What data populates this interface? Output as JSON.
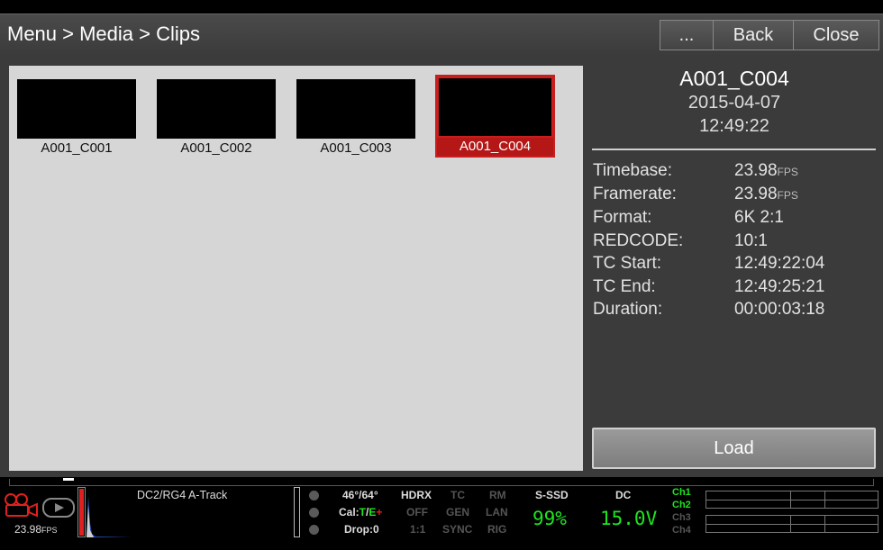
{
  "header": {
    "breadcrumb": "Menu > Media > Clips",
    "more_label": "...",
    "back_label": "Back",
    "close_label": "Close"
  },
  "clips": [
    {
      "name": "A001_C001",
      "selected": false
    },
    {
      "name": "A001_C002",
      "selected": false
    },
    {
      "name": "A001_C003",
      "selected": false
    },
    {
      "name": "A001_C004",
      "selected": true
    }
  ],
  "info": {
    "clip_name": "A001_C004",
    "date": "2015-04-07",
    "time": "12:49:22",
    "fields": [
      {
        "label": "Timebase:",
        "value": "23.98",
        "unit": "FPS"
      },
      {
        "label": "Framerate:",
        "value": "23.98",
        "unit": "FPS"
      },
      {
        "label": "Format:",
        "value": "6K 2:1",
        "unit": ""
      },
      {
        "label": "REDCODE:",
        "value": "10:1",
        "unit": ""
      },
      {
        "label": "TC Start:",
        "value": "12:49:22:04",
        "unit": ""
      },
      {
        "label": "TC End:",
        "value": "12:49:25:21",
        "unit": ""
      },
      {
        "label": "Duration:",
        "value": "00:00:03:18",
        "unit": ""
      }
    ],
    "load_label": "Load"
  },
  "status": {
    "fps": "23.98",
    "fps_unit": "FPS",
    "color_info": "DC2/RG4  A-Track",
    "shutter": "46°/64°",
    "cal_prefix": "Cal:",
    "cal_t": "T",
    "cal_sep": "/",
    "cal_e": "E",
    "cal_plus": "+",
    "drop": "Drop:0",
    "col1": [
      "HDRX",
      "OFF",
      "1:1"
    ],
    "col2": [
      "TC",
      "GEN",
      "SYNC"
    ],
    "col3": [
      "RM",
      "LAN",
      "RIG"
    ],
    "media_label": "S-SSD",
    "media_value": "99%",
    "power_label": "DC",
    "power_value": "15.0V",
    "channels": [
      "Ch1",
      "Ch2",
      "Ch3",
      "Ch4"
    ],
    "colors": {
      "green": "#1ee61e",
      "red": "#e02020",
      "accent": "#c81e1e"
    }
  }
}
